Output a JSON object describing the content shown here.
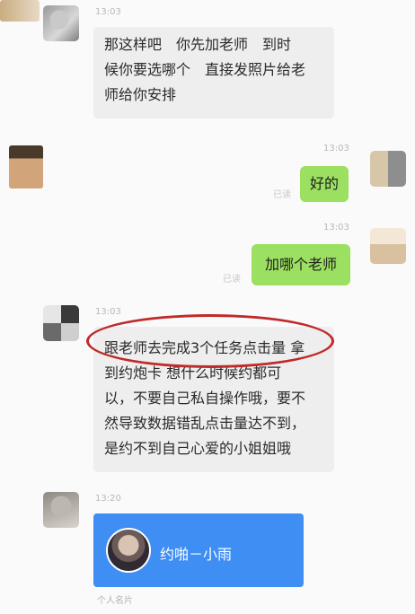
{
  "messages": [
    {
      "id": "msg1",
      "time": "13:03",
      "lines": [
        "那这样吧　你先加老师　到时",
        "候你要选哪个　直接发照片给老",
        "师给你安排"
      ]
    },
    {
      "id": "msg2",
      "time": "13:03",
      "read": "已读",
      "text": "好的"
    },
    {
      "id": "msg3",
      "time": "13:03",
      "read": "已读",
      "text": "加哪个老师"
    },
    {
      "id": "msg4",
      "time": "13:03",
      "lines": [
        "跟老师去完成3个任务点击量 拿",
        "到约炮卡 想什么时候约都可",
        "以，不要自己私自操作哦，要不",
        "然导致数据错乱点击量达不到，",
        "是约不到自己心爱的小姐姐哦"
      ]
    },
    {
      "id": "msg5",
      "time": "13:20",
      "card_name": "约啪－小雨",
      "card_footer": "个人名片"
    }
  ],
  "colors": {
    "incoming_bubble": "#eeeeee",
    "outgoing_bubble": "#9be060",
    "card": "#3f8ef3",
    "highlight_ring": "#c02a2a"
  }
}
